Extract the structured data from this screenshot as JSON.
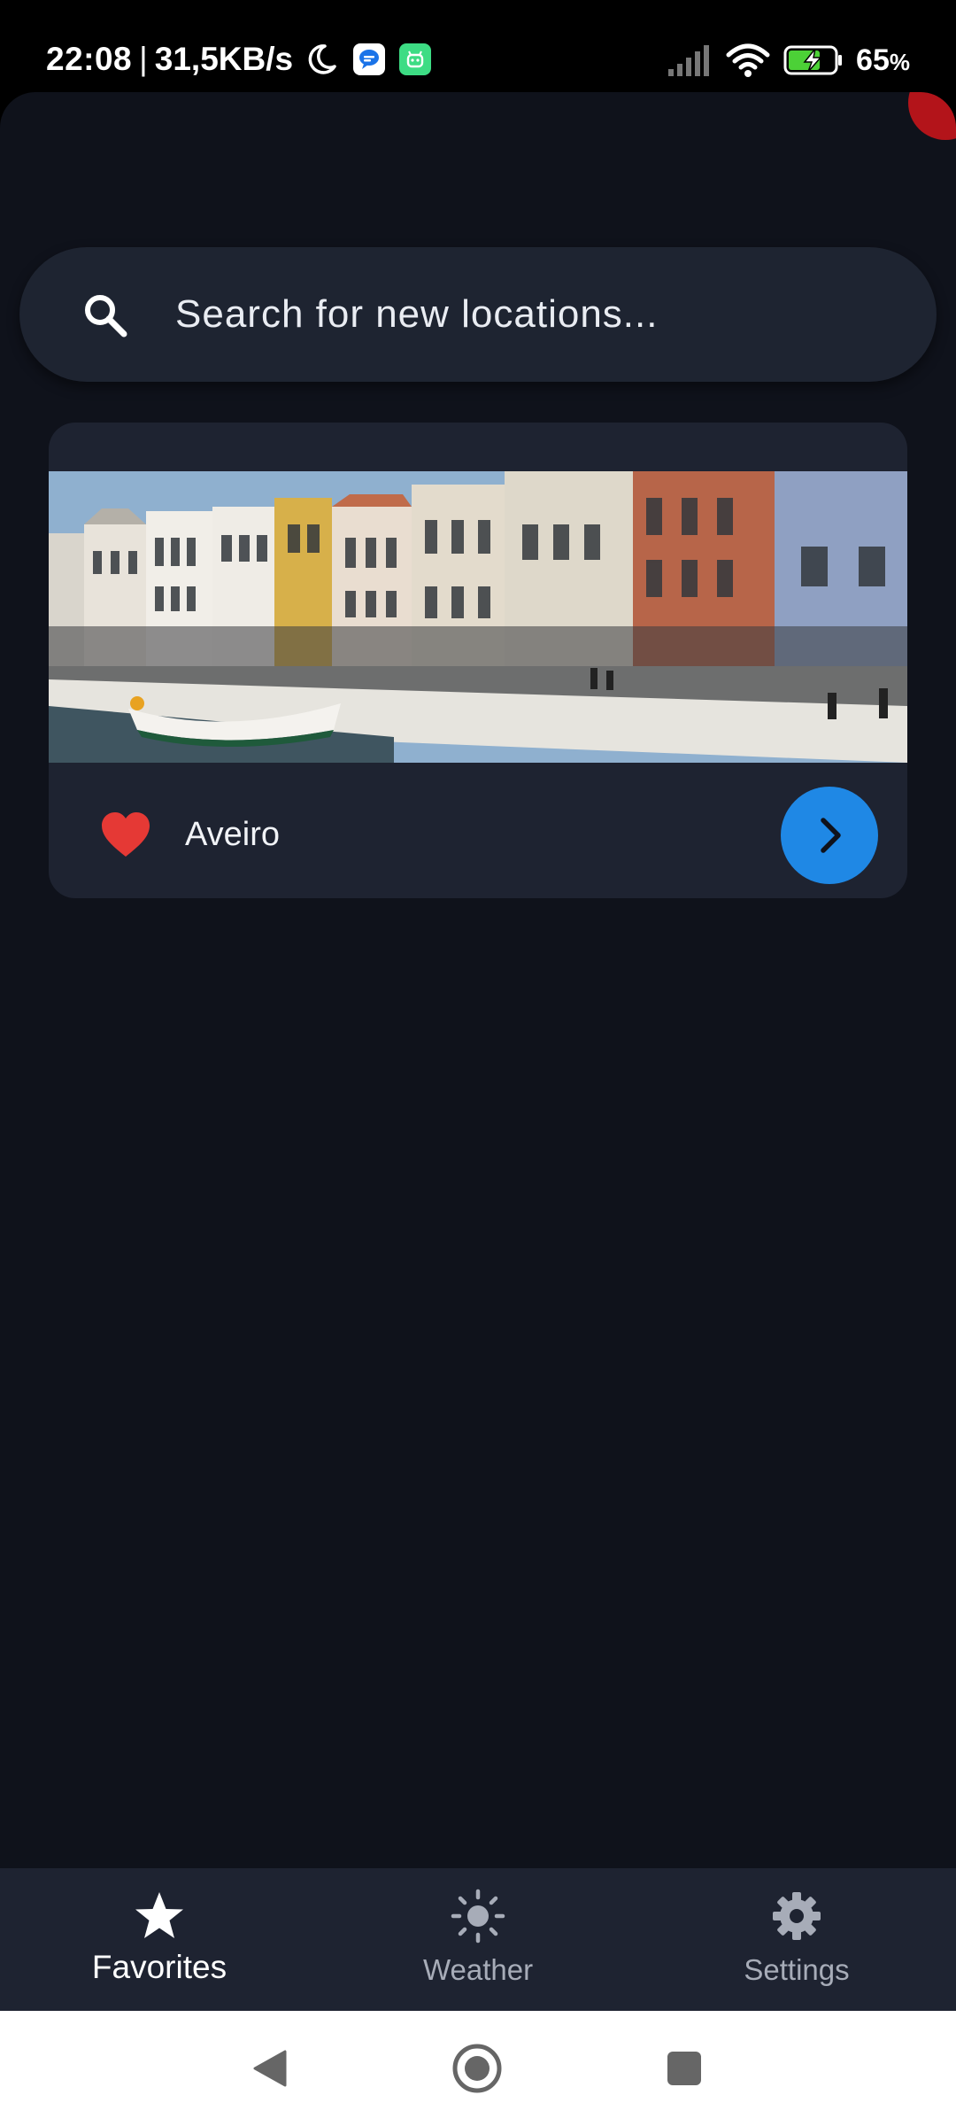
{
  "status_bar": {
    "time": "22:08",
    "separator": "|",
    "network_speed": "31,5KB/s",
    "battery_percent": "65",
    "battery_unit": "%",
    "battery_level": 0.65,
    "icons": [
      "moon-icon",
      "message-app-icon",
      "android-app-icon",
      "signal-icon",
      "wifi-icon",
      "battery-charging-icon"
    ]
  },
  "search": {
    "placeholder": "Search for new locations...",
    "icon": "search-icon"
  },
  "favorites": [
    {
      "name": "Aveiro",
      "favorite": true,
      "icon": "heart-icon",
      "action_icon": "chevron-right-icon"
    }
  ],
  "bottom_nav": {
    "items": [
      {
        "label": "Favorites",
        "icon": "star-icon",
        "active": true
      },
      {
        "label": "Weather",
        "icon": "sun-icon",
        "active": false
      },
      {
        "label": "Settings",
        "icon": "gear-icon",
        "active": false
      }
    ]
  },
  "system_nav": {
    "icons": [
      "back-icon",
      "home-icon",
      "recents-icon"
    ]
  },
  "colors": {
    "background": "#0f121b",
    "surface": "#1e2331",
    "accent": "#1f88e5",
    "heart": "#e53935",
    "corner_accent": "#b3141a"
  }
}
